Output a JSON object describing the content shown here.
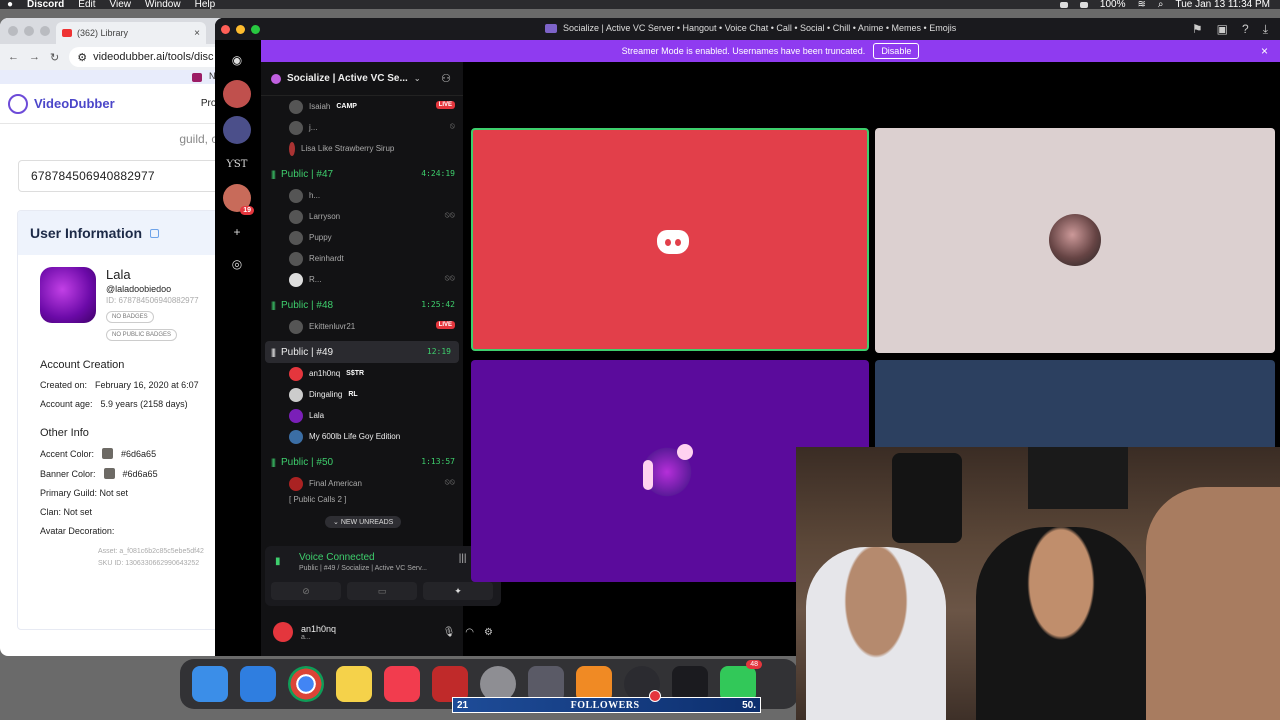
{
  "menubar": {
    "app": "Discord",
    "items": [
      "Edit",
      "View",
      "Window",
      "Help"
    ],
    "battery": "100%",
    "datetime": "Tue Jan 13  11:34 PM"
  },
  "browser": {
    "tab_title": "(362) Library",
    "url": "videodubber.ai/tools/disc",
    "notice": "Nc",
    "brand": "VideoDubber",
    "nav_products": "Prod",
    "hint": "guild, cl",
    "user_id_input": "678784506940882977",
    "card": {
      "title": "User Information",
      "name": "Lala",
      "handle": "@laladoobiedoo",
      "id": "ID: 678784506940882977",
      "badges": "NO BADGES",
      "public_badges": "NO PUBLIC BADGES",
      "account_creation": "Account Creation",
      "created_on_label": "Created on:",
      "created_on": "February 16, 2020 at 6:07",
      "account_age_label": "Account age:",
      "account_age": "5.9 years (2158 days)",
      "other_info": "Other Info",
      "accent_label": "Accent Color:",
      "accent_value": "#6d6a65",
      "banner_label": "Banner Color:",
      "banner_value": "#6d6a65",
      "primary_guild": "Primary Guild: Not set",
      "clan": "Clan: Not set",
      "avatar_decoration": "Avatar Decoration:",
      "asset": "Asset: a_f081c6b2c85c5ebe5df42",
      "sku": "SKU ID: 1306330662990643252"
    }
  },
  "discord": {
    "window_title": "Socialize | Active VC Server • Hangout • Voice Chat • Call • Social • Chill • Anime • Memes • Emojis",
    "banner_text": "Streamer Mode is enabled. Usernames have been truncated.",
    "banner_button": "Disable",
    "server_name": "Socialize | Active VC Se...",
    "rail_badge": "19",
    "rail_label": "ƳST",
    "users_top": [
      {
        "name": "Isaiah",
        "tag": "CAMP",
        "live": "LIVE"
      },
      {
        "name": "j..."
      },
      {
        "name": "Lisa Like Strawberry Sirup"
      }
    ],
    "channels": [
      {
        "name": "Public | #47",
        "time": "4:24:19",
        "users": [
          "h...",
          "Larryson",
          "Puppy",
          "Reinhardt",
          "R..."
        ]
      },
      {
        "name": "Public | #48",
        "time": "1:25:42",
        "users": [
          "Ekittenluvr21"
        ],
        "live": "LIVE"
      },
      {
        "name": "Public | #49",
        "time": "12:19",
        "users": [
          "an1h0nq",
          "Dingaling",
          "Lala",
          "My 600lb Life Goy Edition"
        ],
        "tags": [
          "S$TR",
          "RL"
        ]
      },
      {
        "name": "Public | #50",
        "time": "1:13:57",
        "users": [
          "Final American"
        ]
      }
    ],
    "new_unreads": "NEW UNREADS",
    "partial_channel": "[ Public Calls 2 ]",
    "voice_connected": "Voice Connected",
    "voice_sub": "Public | #49 / Socialize | Active VC Serv...",
    "user_name": "an1h0nq",
    "user_status": "a..."
  },
  "dock": {
    "messages_badge": "48"
  },
  "overlay": {
    "left_num": "21",
    "label": "FOLLOWERS",
    "right_num": "50."
  }
}
